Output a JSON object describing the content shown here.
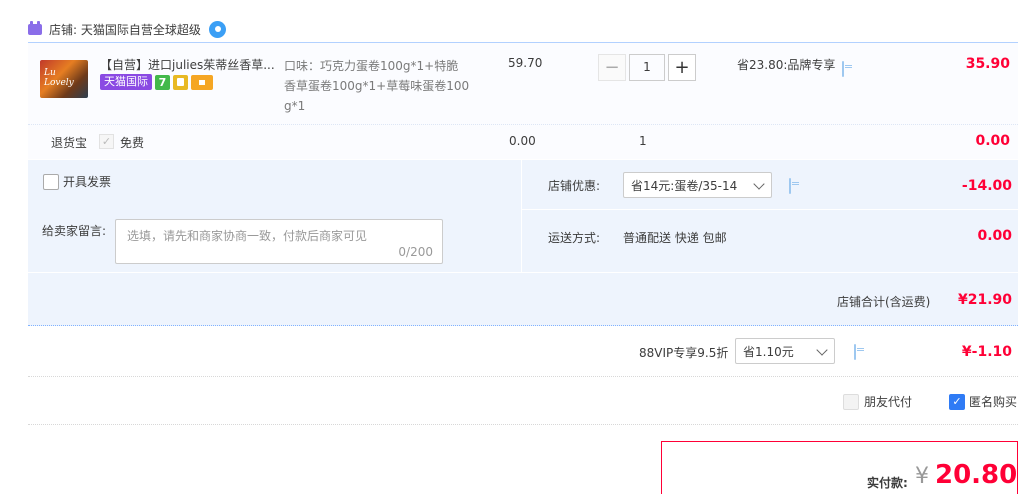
{
  "shop": {
    "label": "店铺: 天猫国际自营全球超级"
  },
  "item": {
    "thumb_text": "Lu Lovely",
    "title": "【自营】进口julies茱蒂丝香草...",
    "tag_tmall": "天猫国际",
    "tag_7": "7",
    "sku": "口味：巧克力蛋卷100g*1+特脆香草蛋卷100g*1+草莓味蛋卷100g*1",
    "unit_price": "59.70",
    "quantity": "1",
    "qty_minus": "−",
    "qty_plus": "+",
    "discount": "省23.80:品牌专享",
    "total": "35.90"
  },
  "refund": {
    "label": "退货宝",
    "check": "✓",
    "free": "免费",
    "price": "0.00",
    "qty": "1",
    "total": "0.00"
  },
  "invoice": {
    "label": "开具发票"
  },
  "memo": {
    "label": "给卖家留言:",
    "placeholder": "选填，请先和商家协商一致，付款后商家可见",
    "count": "0/200"
  },
  "shop_discount": {
    "label": "店铺优惠:",
    "selected": "省14元:蛋卷/35-14",
    "value": "-14.00"
  },
  "shipping": {
    "label": "运送方式:",
    "method": "普通配送 快递 包邮",
    "price": "0.00"
  },
  "shop_subtotal": {
    "label": "店铺合计(含运费)",
    "value": "¥21.90"
  },
  "vip": {
    "label": "88VIP专享9.5折",
    "selected": "省1.10元",
    "value": "¥-1.10"
  },
  "options": {
    "friend_pay": "朋友代付",
    "anonymous": "匿名购买",
    "anonymous_check": "✓"
  },
  "payment": {
    "label": "实付款:",
    "currency": "¥",
    "amount": "20.80"
  },
  "colors": {
    "price_red": "#ff0036",
    "tmall_purple": "#8a4ae3",
    "accent_blue": "#2f7bf5",
    "panel_blue": "#eef4fd"
  }
}
